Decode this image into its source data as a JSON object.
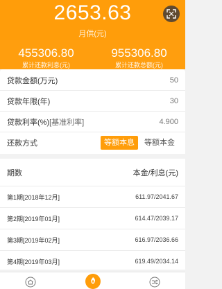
{
  "header": {
    "monthly_payment": "2653.63",
    "monthly_label": "月供(元)",
    "total_interest": "455306.80",
    "total_interest_label": "累计还款利息(元)",
    "total_payment": "955306.80",
    "total_payment_label": "累计还款总额(元)"
  },
  "form": {
    "amount_label": "贷款金额(万元)",
    "amount_value": "50",
    "years_label": "贷款年限(年)",
    "years_value": "30",
    "rate_label": "贷款利率(%)",
    "rate_bracket": "[基准利率]",
    "rate_value": "4.900",
    "method_label": "还款方式",
    "method_options": [
      "等额本息",
      "等额本金"
    ],
    "method_selected": "等额本息"
  },
  "table": {
    "col_period": "期数",
    "col_amount": "本金/利息(元)",
    "rows": [
      {
        "period": "第1期[2018年12月]",
        "amount": "611.97/2041.67"
      },
      {
        "period": "第2期[2019年01月]",
        "amount": "614.47/2039.17"
      },
      {
        "period": "第3期[2019年02月]",
        "amount": "616.97/2036.66"
      },
      {
        "period": "第4期[2019年03月]",
        "amount": "619.49/2034.14"
      }
    ]
  },
  "tabbar": {
    "icons": [
      "home-icon",
      "calculator-icon",
      "shuffle-icon"
    ]
  },
  "colors": {
    "accent": "#ff9d0a",
    "share_button": "#5f4a31"
  }
}
